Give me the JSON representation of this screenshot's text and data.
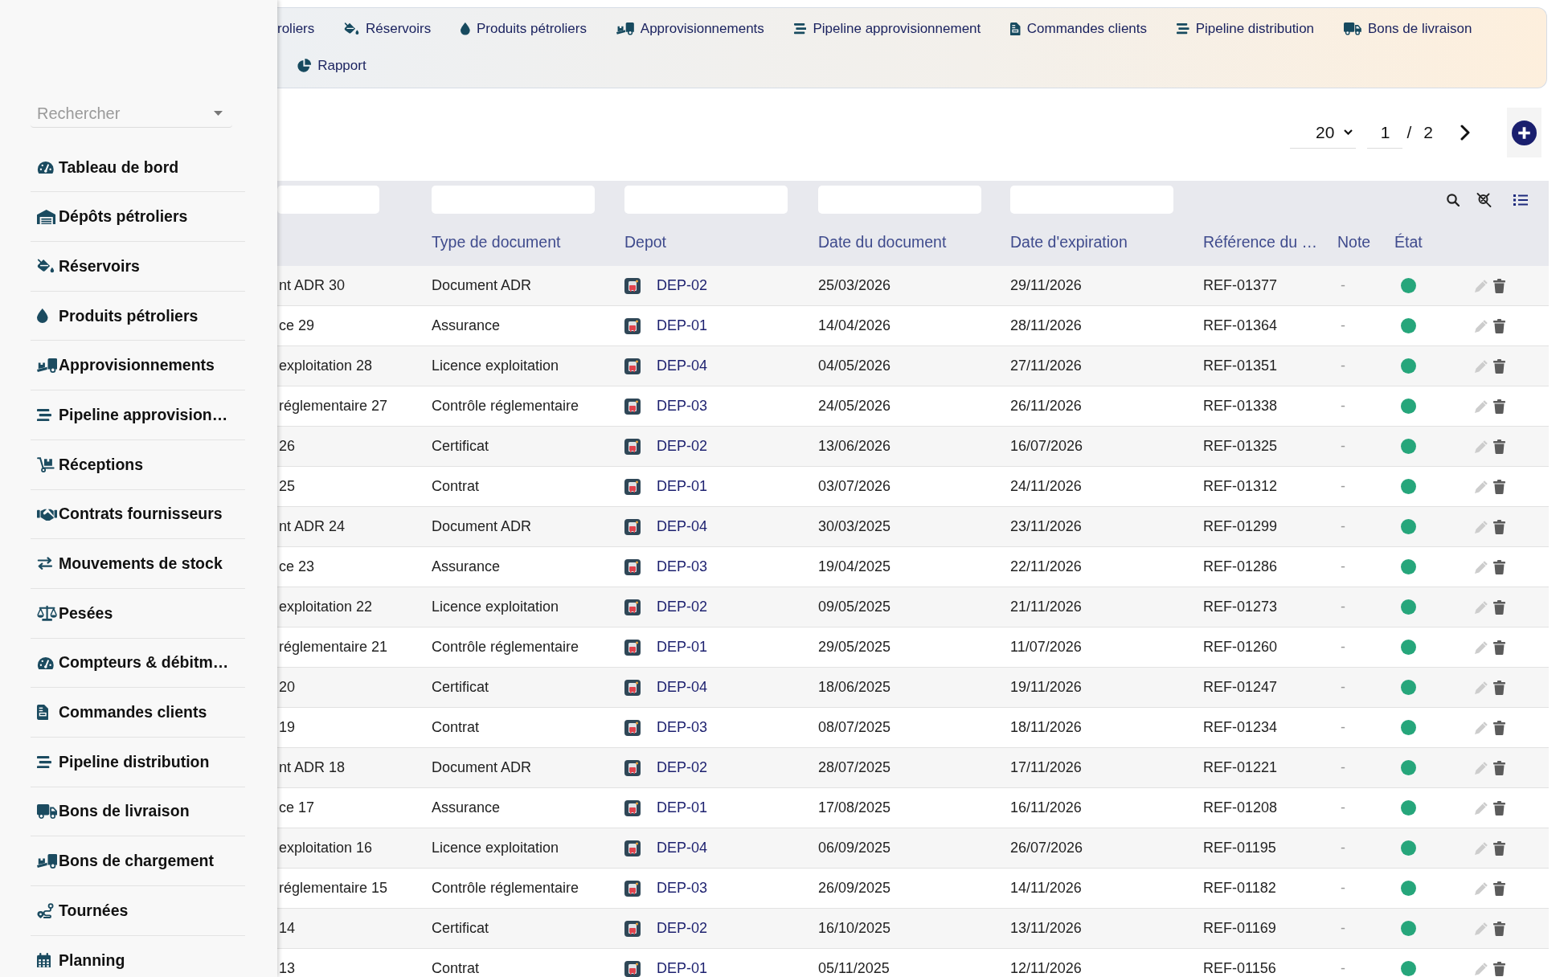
{
  "sidebar": {
    "search": {
      "placeholder": "Rechercher"
    },
    "items": [
      {
        "label": "Tableau de bord",
        "selected": false
      },
      {
        "label": "Dépôts pétroliers",
        "selected": false
      },
      {
        "label": "Réservoirs",
        "selected": false
      },
      {
        "label": "Produits pétroliers",
        "selected": false
      },
      {
        "label": "Approvisionnements",
        "selected": false
      },
      {
        "label": "Pipeline approvision…",
        "selected": false
      },
      {
        "label": "Réceptions",
        "selected": false
      },
      {
        "label": "Contrats fournisseurs",
        "selected": false
      },
      {
        "label": "Mouvements de stock",
        "selected": false
      },
      {
        "label": "Pesées",
        "selected": false
      },
      {
        "label": "Compteurs & débitm…",
        "selected": false
      },
      {
        "label": "Commandes clients",
        "selected": false
      },
      {
        "label": "Pipeline distribution",
        "selected": false
      },
      {
        "label": "Bons de livraison",
        "selected": false
      },
      {
        "label": "Bons de chargement",
        "selected": false
      },
      {
        "label": "Tournées",
        "selected": false
      },
      {
        "label": "Planning",
        "selected": false
      }
    ]
  },
  "nav": {
    "rows": [
      [
        {
          "label": "roliers",
          "selected": false
        },
        {
          "label": "Réservoirs",
          "selected": false
        },
        {
          "label": "Produits pétroliers",
          "selected": false
        },
        {
          "label": "Approvisionnements",
          "selected": false
        },
        {
          "label": "Pipeline approvisionnement",
          "selected": false
        },
        {
          "label": "Commandes clients",
          "selected": false
        },
        {
          "label": "Pipeline distribution",
          "selected": false
        },
        {
          "label": "Bons de livraison",
          "selected": false
        }
      ],
      [
        {
          "label": "Rapport",
          "selected": false
        }
      ]
    ]
  },
  "pagination": {
    "page_size": "20",
    "page": "1",
    "separator": "/",
    "total_pages": "2"
  },
  "table": {
    "columns": [
      {
        "kind": "text",
        "filter": true
      },
      {
        "kind": "text",
        "label": "Type de document",
        "filter": true
      },
      {
        "kind": "link",
        "label": "Depot",
        "filter": true
      },
      {
        "kind": "text",
        "label": "Date du document",
        "filter": true
      },
      {
        "kind": "text",
        "label": "Date d'expiration",
        "filter": true
      },
      {
        "kind": "text",
        "label": "Référence du …",
        "filter": false
      },
      {
        "kind": "muted",
        "label": "Note",
        "filter": false
      },
      {
        "kind": "status",
        "label": "État",
        "filter": false
      }
    ],
    "rows": [
      {
        "cells": [
          "nt ADR 30",
          "Document ADR",
          "DEP-02",
          "25/03/2026",
          "29/11/2026",
          "REF-01377",
          "-"
        ],
        "color": "#26a67b"
      },
      {
        "cells": [
          "ce 29",
          "Assurance",
          "DEP-01",
          "14/04/2026",
          "28/11/2026",
          "REF-01364",
          "-"
        ],
        "color": "#26a67b"
      },
      {
        "cells": [
          "exploitation 28",
          "Licence exploitation",
          "DEP-04",
          "04/05/2026",
          "27/11/2026",
          "REF-01351",
          "-"
        ],
        "color": "#26a67b"
      },
      {
        "cells": [
          "réglementaire 27",
          "Contrôle réglementaire",
          "DEP-03",
          "24/05/2026",
          "26/11/2026",
          "REF-01338",
          "-"
        ],
        "color": "#26a67b"
      },
      {
        "cells": [
          "26",
          "Certificat",
          "DEP-02",
          "13/06/2026",
          "16/07/2026",
          "REF-01325",
          "-"
        ],
        "color": "#26a67b"
      },
      {
        "cells": [
          "25",
          "Contrat",
          "DEP-01",
          "03/07/2026",
          "24/11/2026",
          "REF-01312",
          "-"
        ],
        "color": "#26a67b"
      },
      {
        "cells": [
          "nt ADR 24",
          "Document ADR",
          "DEP-04",
          "30/03/2025",
          "23/11/2026",
          "REF-01299",
          "-"
        ],
        "color": "#26a67b"
      },
      {
        "cells": [
          "ce 23",
          "Assurance",
          "DEP-03",
          "19/04/2025",
          "22/11/2026",
          "REF-01286",
          "-"
        ],
        "color": "#26a67b"
      },
      {
        "cells": [
          "exploitation 22",
          "Licence exploitation",
          "DEP-02",
          "09/05/2025",
          "21/11/2026",
          "REF-01273",
          "-"
        ],
        "color": "#26a67b"
      },
      {
        "cells": [
          "réglementaire 21",
          "Contrôle réglementaire",
          "DEP-01",
          "29/05/2025",
          "11/07/2026",
          "REF-01260",
          "-"
        ],
        "color": "#26a67b"
      },
      {
        "cells": [
          "20",
          "Certificat",
          "DEP-04",
          "18/06/2025",
          "19/11/2026",
          "REF-01247",
          "-"
        ],
        "color": "#26a67b"
      },
      {
        "cells": [
          "19",
          "Contrat",
          "DEP-03",
          "08/07/2025",
          "18/11/2026",
          "REF-01234",
          "-"
        ],
        "color": "#26a67b"
      },
      {
        "cells": [
          "nt ADR 18",
          "Document ADR",
          "DEP-02",
          "28/07/2025",
          "17/11/2026",
          "REF-01221",
          "-"
        ],
        "color": "#26a67b"
      },
      {
        "cells": [
          "ce 17",
          "Assurance",
          "DEP-01",
          "17/08/2025",
          "16/11/2026",
          "REF-01208",
          "-"
        ],
        "color": "#26a67b"
      },
      {
        "cells": [
          "exploitation 16",
          "Licence exploitation",
          "DEP-04",
          "06/09/2025",
          "26/07/2026",
          "REF-01195",
          "-"
        ],
        "color": "#26a67b"
      },
      {
        "cells": [
          "réglementaire 15",
          "Contrôle réglementaire",
          "DEP-03",
          "26/09/2025",
          "14/11/2026",
          "REF-01182",
          "-"
        ],
        "color": "#26a67b"
      },
      {
        "cells": [
          "14",
          "Certificat",
          "DEP-02",
          "16/10/2025",
          "13/11/2026",
          "REF-01169",
          "-"
        ],
        "color": "#26a67b"
      },
      {
        "cells": [
          "13",
          "Contrat",
          "DEP-01",
          "05/11/2025",
          "12/11/2026",
          "REF-01156",
          "-"
        ],
        "color": "#26a67b"
      }
    ]
  }
}
